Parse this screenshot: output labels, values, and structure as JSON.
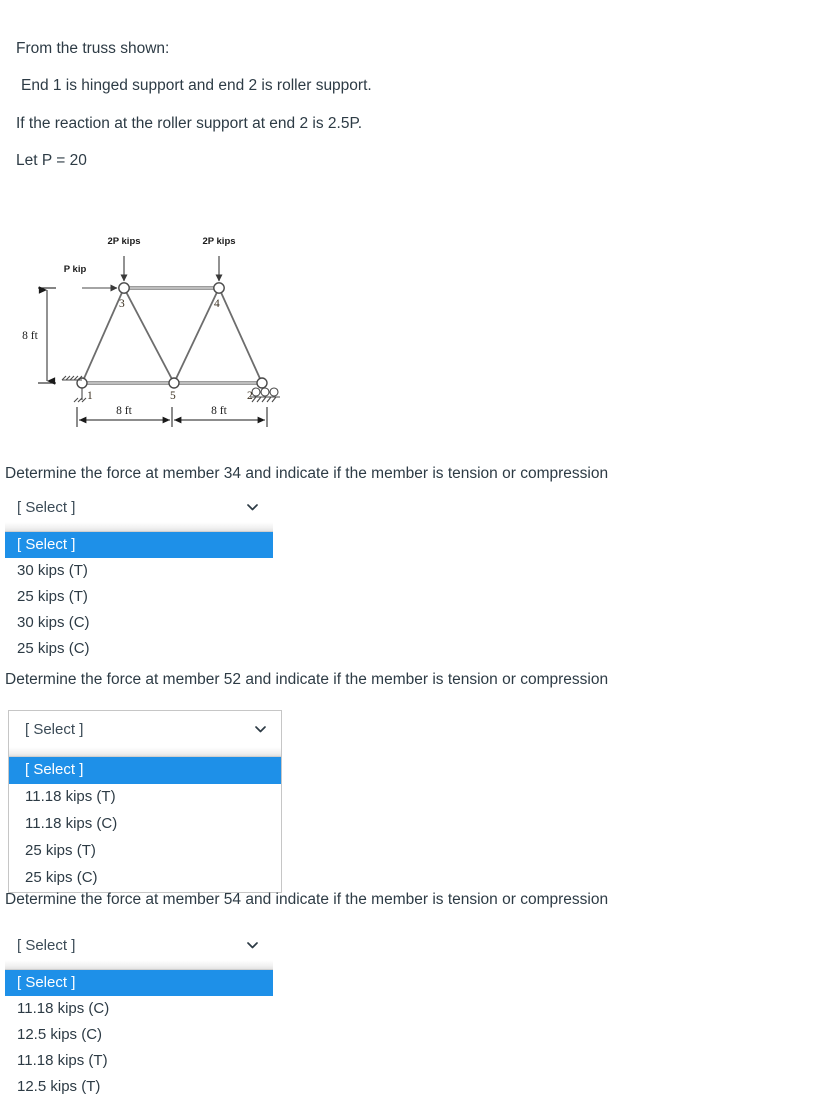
{
  "prompt": {
    "lines": [
      "From the truss shown:",
      " End 1 is hinged support and end 2 is roller support.",
      "If the reaction at the roller support at end 2 is 2.5P.",
      "Let P = 20"
    ]
  },
  "figure": {
    "load_label_left": "2P kips",
    "load_label_right": "2P kips",
    "side_load_label": "P kip",
    "height_label": "8 ft",
    "span_label_left": "8 ft",
    "span_label_right": "8 ft",
    "nodes": [
      {
        "id": "1",
        "label": "1"
      },
      {
        "id": "2",
        "label": "2"
      },
      {
        "id": "3",
        "label": "3"
      },
      {
        "id": "4",
        "label": "4"
      },
      {
        "id": "5",
        "label": "5"
      }
    ]
  },
  "questions": [
    {
      "text": "Determine the force at member 34 and indicate if the member is tension or compression",
      "select_value": "[ Select ]",
      "options": [
        "[ Select ]",
        "30 kips (T)",
        "25 kips (T)",
        "30 kips (C)",
        "25 kips (C)"
      ]
    },
    {
      "text": "Determine the force at member 52 and indicate if the member is tension or compression",
      "select_value": "[ Select ]",
      "options": [
        "[ Select ]",
        "11.18 kips (T)",
        "11.18 kips (C)",
        "25 kips (T)",
        "25 kips (C)"
      ]
    },
    {
      "text": "Determine the force at member 54 and indicate if the member is tension or compression",
      "select_value": "[ Select ]",
      "options": [
        "[ Select ]",
        "11.18 kips (C)",
        "12.5 kips (C)",
        "11.18 kips (T)",
        "12.5 kips (T)"
      ]
    }
  ],
  "colors": {
    "highlight": "#1e90e8",
    "text": "#2d3b45",
    "diagram_line": "#6b6b6b"
  }
}
